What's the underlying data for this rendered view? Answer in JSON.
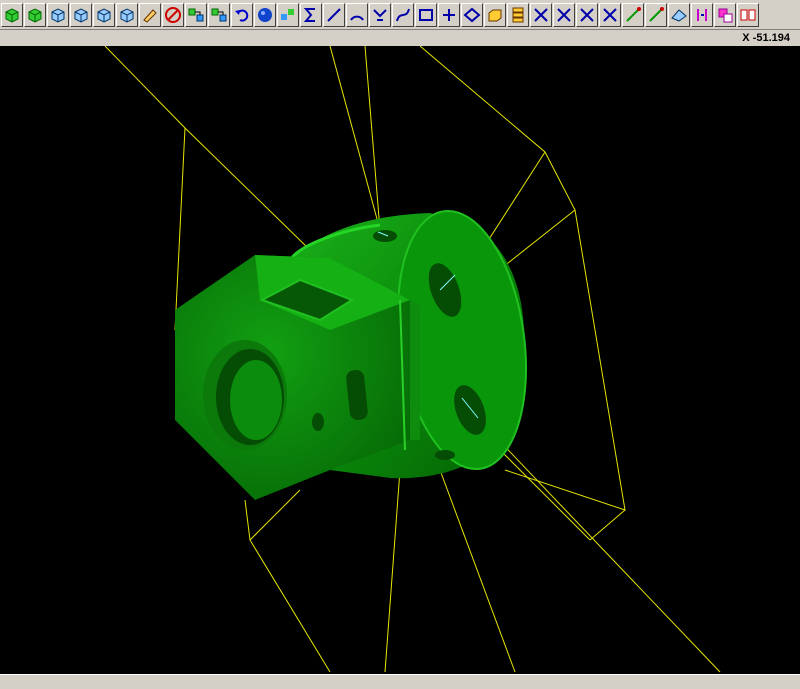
{
  "toolbar": {
    "buttons": [
      {
        "name": "view-cube-green-button",
        "icon": "cube-green-icon"
      },
      {
        "name": "view-cube-green2-button",
        "icon": "cube-green-icon"
      },
      {
        "name": "view-iso-button",
        "icon": "cube-blue-icon"
      },
      {
        "name": "view-front-button",
        "icon": "cube-blue-icon"
      },
      {
        "name": "view-side-button",
        "icon": "cube-blue-icon"
      },
      {
        "name": "view-top-button",
        "icon": "cube-blue-icon"
      },
      {
        "name": "erase-button",
        "icon": "eraser-icon"
      },
      {
        "name": "cancel-button",
        "icon": "cancel-icon"
      },
      {
        "name": "transform-button",
        "icon": "transform-icon"
      },
      {
        "name": "transform2-button",
        "icon": "transform-icon"
      },
      {
        "name": "undo-button",
        "icon": "undo-icon"
      },
      {
        "name": "sphere-button",
        "icon": "sphere-icon"
      },
      {
        "name": "group-button",
        "icon": "group-icon"
      },
      {
        "name": "sum-button",
        "icon": "sigma-icon"
      },
      {
        "name": "line-button",
        "icon": "line-icon"
      },
      {
        "name": "arc-button",
        "icon": "arc-icon"
      },
      {
        "name": "fillet-button",
        "icon": "fillet-icon"
      },
      {
        "name": "spline-button",
        "icon": "spline-icon"
      },
      {
        "name": "rectangle-button",
        "icon": "rectangle-icon"
      },
      {
        "name": "point-button",
        "icon": "plus-icon"
      },
      {
        "name": "plane-button",
        "icon": "plane-icon"
      },
      {
        "name": "solid-box-button",
        "icon": "box-icon"
      },
      {
        "name": "stack-button",
        "icon": "stack-icon"
      },
      {
        "name": "cross-lines-button",
        "icon": "cross-lines-icon"
      },
      {
        "name": "cross-lines2-button",
        "icon": "cross-lines-icon"
      },
      {
        "name": "cross-lines3-button",
        "icon": "cross-lines-icon"
      },
      {
        "name": "cross-lines4-button",
        "icon": "cross-lines-icon"
      },
      {
        "name": "diagonal-button",
        "icon": "diagonal-icon"
      },
      {
        "name": "diagonal2-button",
        "icon": "diagonal-icon"
      },
      {
        "name": "surface-button",
        "icon": "surface-icon"
      },
      {
        "name": "split-button",
        "icon": "split-icon"
      },
      {
        "name": "layer-button",
        "icon": "layer-icon"
      },
      {
        "name": "merge-button",
        "icon": "merge-icon"
      }
    ]
  },
  "coordinate_readout": "X -51.194",
  "colors": {
    "background": "#000000",
    "model": "#008c00",
    "model_highlight": "#18d018",
    "wireframe": "#e6e600",
    "toolbar": "#d4d0c8"
  }
}
